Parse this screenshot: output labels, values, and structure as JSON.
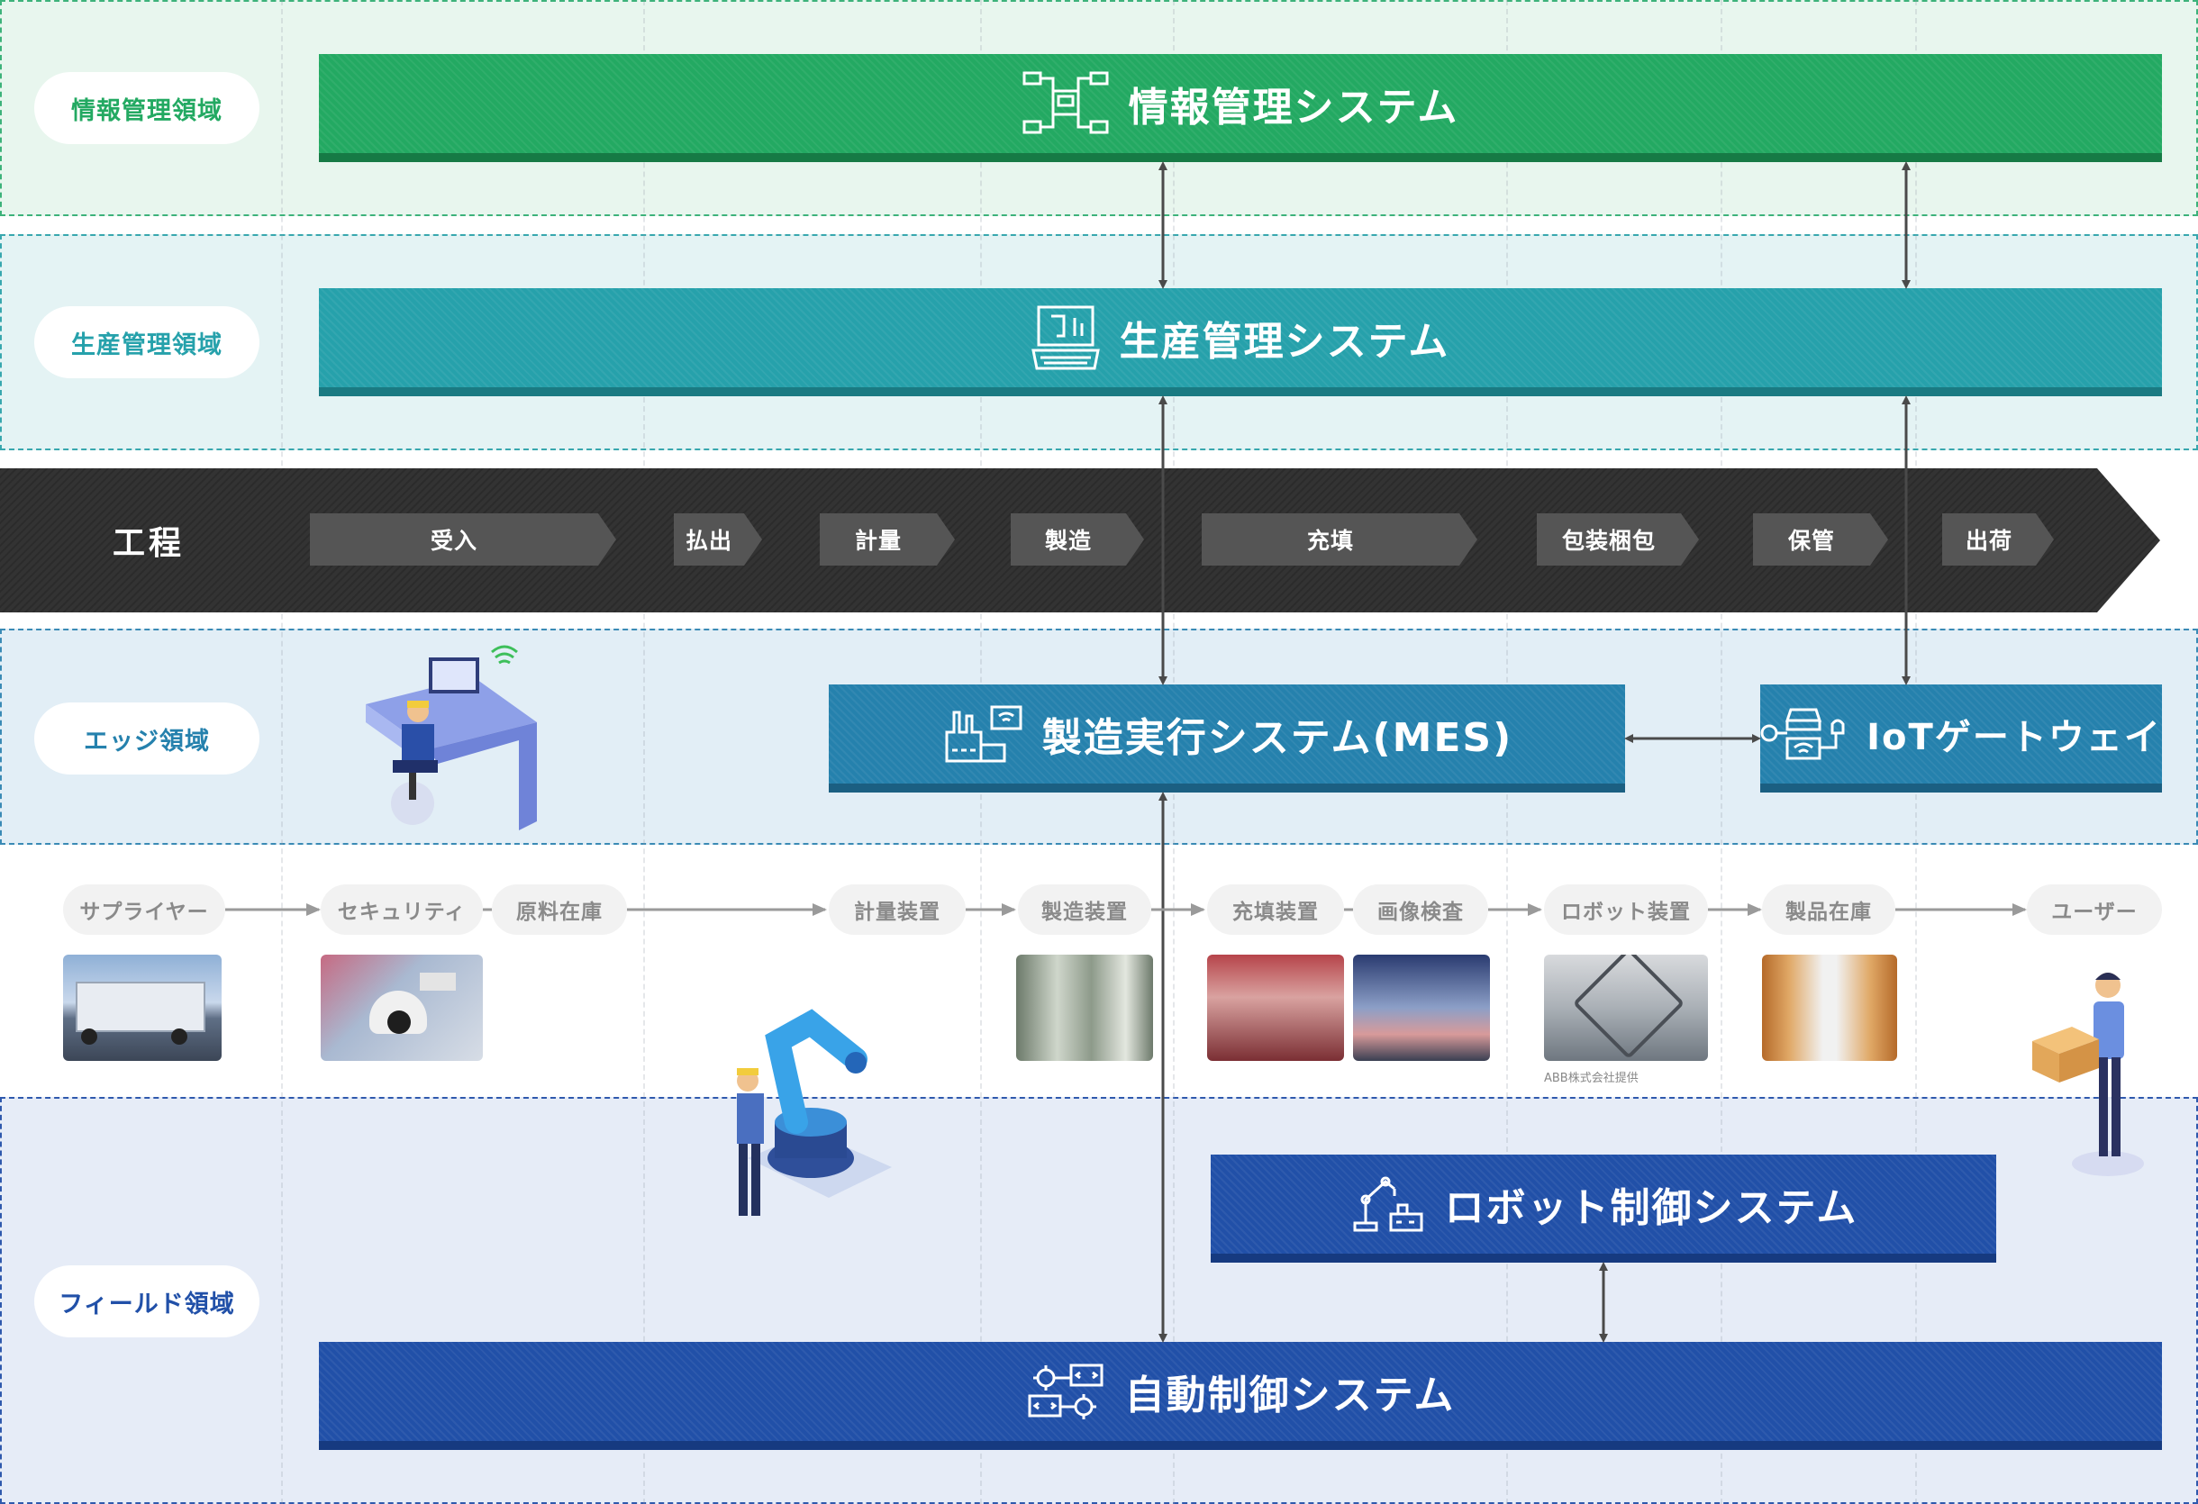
{
  "domains": {
    "info": "情報管理領域",
    "production": "生産管理領域",
    "edge": "エッジ領域",
    "field": "フィールド領域"
  },
  "systems": {
    "info": "情報管理システム",
    "production": "生産管理システム",
    "mes": "製造実行システム(MES)",
    "iot": "IoTゲートウェイ",
    "robot": "ロボット制御システム",
    "auto": "自動制御システム"
  },
  "process": {
    "label": "工程",
    "steps": [
      "受入",
      "払出",
      "計量",
      "製造",
      "充填",
      "包装梱包",
      "保管",
      "出荷"
    ]
  },
  "flow": [
    "サプライヤー",
    "セキュリティ",
    "原料在庫",
    "計量装置",
    "製造装置",
    "充填装置",
    "画像検査",
    "ロボット装置",
    "製品在庫",
    "ユーザー"
  ],
  "credit": "ABB株式会社提供",
  "colors": {
    "info": "#23a962",
    "production": "#26a1ab",
    "edge": "#2581ad",
    "field": "#2150a8",
    "process": "#333333"
  }
}
